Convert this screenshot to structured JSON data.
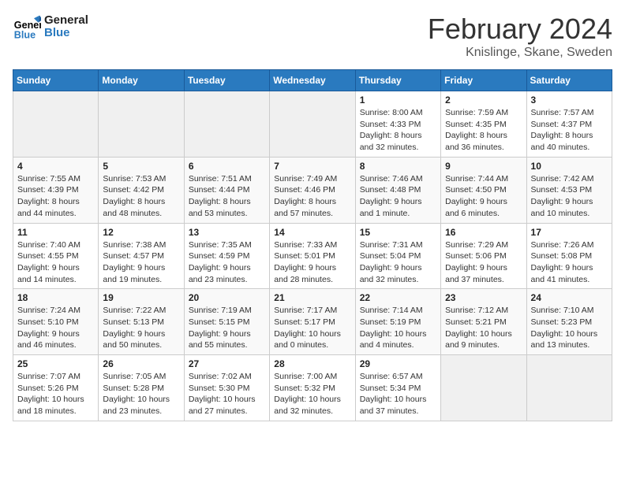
{
  "logo": {
    "line1": "General",
    "line2": "Blue"
  },
  "title": "February 2024",
  "subtitle": "Knislinge, Skane, Sweden",
  "weekdays": [
    "Sunday",
    "Monday",
    "Tuesday",
    "Wednesday",
    "Thursday",
    "Friday",
    "Saturday"
  ],
  "weeks": [
    [
      {
        "day": "",
        "info": ""
      },
      {
        "day": "",
        "info": ""
      },
      {
        "day": "",
        "info": ""
      },
      {
        "day": "",
        "info": ""
      },
      {
        "day": "1",
        "info": "Sunrise: 8:00 AM\nSunset: 4:33 PM\nDaylight: 8 hours\nand 32 minutes."
      },
      {
        "day": "2",
        "info": "Sunrise: 7:59 AM\nSunset: 4:35 PM\nDaylight: 8 hours\nand 36 minutes."
      },
      {
        "day": "3",
        "info": "Sunrise: 7:57 AM\nSunset: 4:37 PM\nDaylight: 8 hours\nand 40 minutes."
      }
    ],
    [
      {
        "day": "4",
        "info": "Sunrise: 7:55 AM\nSunset: 4:39 PM\nDaylight: 8 hours\nand 44 minutes."
      },
      {
        "day": "5",
        "info": "Sunrise: 7:53 AM\nSunset: 4:42 PM\nDaylight: 8 hours\nand 48 minutes."
      },
      {
        "day": "6",
        "info": "Sunrise: 7:51 AM\nSunset: 4:44 PM\nDaylight: 8 hours\nand 53 minutes."
      },
      {
        "day": "7",
        "info": "Sunrise: 7:49 AM\nSunset: 4:46 PM\nDaylight: 8 hours\nand 57 minutes."
      },
      {
        "day": "8",
        "info": "Sunrise: 7:46 AM\nSunset: 4:48 PM\nDaylight: 9 hours\nand 1 minute."
      },
      {
        "day": "9",
        "info": "Sunrise: 7:44 AM\nSunset: 4:50 PM\nDaylight: 9 hours\nand 6 minutes."
      },
      {
        "day": "10",
        "info": "Sunrise: 7:42 AM\nSunset: 4:53 PM\nDaylight: 9 hours\nand 10 minutes."
      }
    ],
    [
      {
        "day": "11",
        "info": "Sunrise: 7:40 AM\nSunset: 4:55 PM\nDaylight: 9 hours\nand 14 minutes."
      },
      {
        "day": "12",
        "info": "Sunrise: 7:38 AM\nSunset: 4:57 PM\nDaylight: 9 hours\nand 19 minutes."
      },
      {
        "day": "13",
        "info": "Sunrise: 7:35 AM\nSunset: 4:59 PM\nDaylight: 9 hours\nand 23 minutes."
      },
      {
        "day": "14",
        "info": "Sunrise: 7:33 AM\nSunset: 5:01 PM\nDaylight: 9 hours\nand 28 minutes."
      },
      {
        "day": "15",
        "info": "Sunrise: 7:31 AM\nSunset: 5:04 PM\nDaylight: 9 hours\nand 32 minutes."
      },
      {
        "day": "16",
        "info": "Sunrise: 7:29 AM\nSunset: 5:06 PM\nDaylight: 9 hours\nand 37 minutes."
      },
      {
        "day": "17",
        "info": "Sunrise: 7:26 AM\nSunset: 5:08 PM\nDaylight: 9 hours\nand 41 minutes."
      }
    ],
    [
      {
        "day": "18",
        "info": "Sunrise: 7:24 AM\nSunset: 5:10 PM\nDaylight: 9 hours\nand 46 minutes."
      },
      {
        "day": "19",
        "info": "Sunrise: 7:22 AM\nSunset: 5:13 PM\nDaylight: 9 hours\nand 50 minutes."
      },
      {
        "day": "20",
        "info": "Sunrise: 7:19 AM\nSunset: 5:15 PM\nDaylight: 9 hours\nand 55 minutes."
      },
      {
        "day": "21",
        "info": "Sunrise: 7:17 AM\nSunset: 5:17 PM\nDaylight: 10 hours\nand 0 minutes."
      },
      {
        "day": "22",
        "info": "Sunrise: 7:14 AM\nSunset: 5:19 PM\nDaylight: 10 hours\nand 4 minutes."
      },
      {
        "day": "23",
        "info": "Sunrise: 7:12 AM\nSunset: 5:21 PM\nDaylight: 10 hours\nand 9 minutes."
      },
      {
        "day": "24",
        "info": "Sunrise: 7:10 AM\nSunset: 5:23 PM\nDaylight: 10 hours\nand 13 minutes."
      }
    ],
    [
      {
        "day": "25",
        "info": "Sunrise: 7:07 AM\nSunset: 5:26 PM\nDaylight: 10 hours\nand 18 minutes."
      },
      {
        "day": "26",
        "info": "Sunrise: 7:05 AM\nSunset: 5:28 PM\nDaylight: 10 hours\nand 23 minutes."
      },
      {
        "day": "27",
        "info": "Sunrise: 7:02 AM\nSunset: 5:30 PM\nDaylight: 10 hours\nand 27 minutes."
      },
      {
        "day": "28",
        "info": "Sunrise: 7:00 AM\nSunset: 5:32 PM\nDaylight: 10 hours\nand 32 minutes."
      },
      {
        "day": "29",
        "info": "Sunrise: 6:57 AM\nSunset: 5:34 PM\nDaylight: 10 hours\nand 37 minutes."
      },
      {
        "day": "",
        "info": ""
      },
      {
        "day": "",
        "info": ""
      }
    ]
  ]
}
